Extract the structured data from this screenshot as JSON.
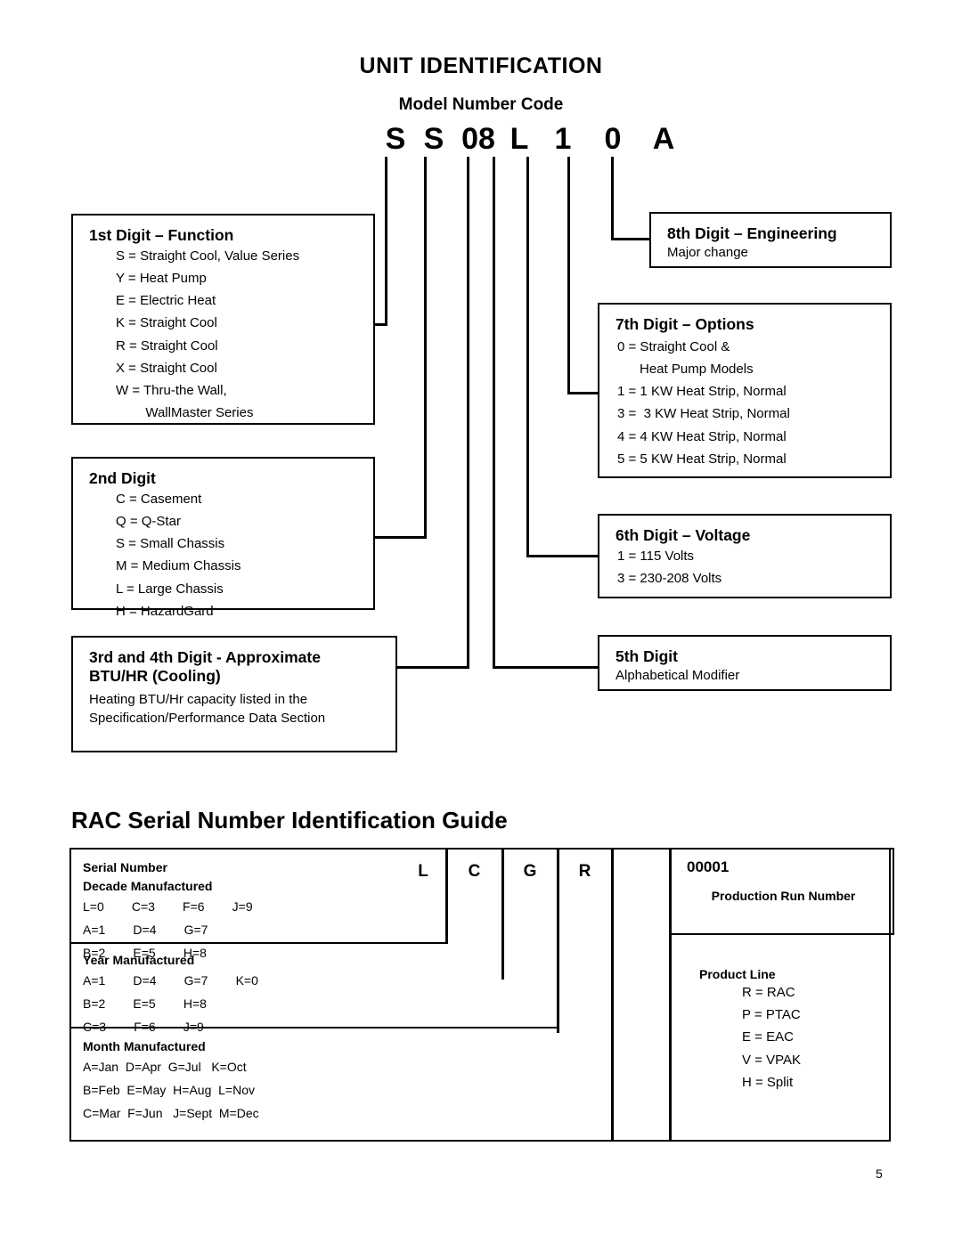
{
  "page": {
    "title": "UNIT IDENTIFICATION",
    "subtitle": "Model Number Code",
    "page_number": "5"
  },
  "model_code": {
    "digits": [
      "S",
      "S",
      "08",
      "L",
      "1",
      "0",
      "A"
    ]
  },
  "boxes": {
    "first_digit": {
      "heading": "1st Digit – Function",
      "items": [
        "S = Straight Cool, Value Series",
        "Y = Heat Pump",
        "E = Electric Heat",
        "K = Straight Cool",
        "R = Straight Cool",
        "X = Straight Cool",
        "W = Thru-the Wall,",
        "        WallMaster Series"
      ]
    },
    "second_digit": {
      "heading": "2nd Digit",
      "items": [
        "C = Casement",
        "Q = Q-Star",
        "S = Small Chassis",
        "M = Medium Chassis",
        "L = Large Chassis",
        "H = HazardGard"
      ]
    },
    "third_fourth_digit": {
      "heading": "3rd and 4th Digit - Approximate BTU/HR (Cooling)",
      "body_line1": "Heating BTU/Hr capacity listed in the",
      "body_line2": "Specification/Performance Data Section"
    },
    "fifth_digit": {
      "heading": "5th Digit",
      "body": "Alphabetical Modifier"
    },
    "sixth_digit": {
      "heading": "6th Digit – Voltage",
      "items": [
        "1 = 115 Volts",
        "3 = 230-208 Volts"
      ]
    },
    "seventh_digit": {
      "heading": "7th Digit – Options",
      "items": [
        "0 = Straight Cool &",
        "      Heat Pump Models",
        "1 = 1 KW Heat Strip, Normal",
        "3 =  3 KW Heat Strip, Normal",
        "4 = 4 KW Heat Strip, Normal",
        "5 = 5 KW Heat Strip, Normal"
      ]
    },
    "eighth_digit": {
      "heading": "8th Digit – Engineering",
      "body": "Major change"
    }
  },
  "serial_guide": {
    "heading": "RAC Serial Number Identification Guide",
    "code_cells": [
      "L",
      "C",
      "G",
      "R"
    ],
    "production_run": {
      "value": "00001",
      "label": "Production Run Number"
    },
    "decade": {
      "title_line1": "Serial Number",
      "title_line2": "Decade Manufactured",
      "rows": [
        "L=0        C=3        F=6        J=9",
        "A=1        D=4        G=7",
        "B=2        E=5        H=8"
      ]
    },
    "year": {
      "title": "Year Manufactured",
      "rows": [
        "A=1        D=4        G=7        K=0",
        "B=2        E=5        H=8",
        "C=3        F=6        J=9"
      ]
    },
    "month": {
      "title": "Month Manufactured",
      "rows": [
        "A=Jan  D=Apr  G=Jul   K=Oct",
        "B=Feb  E=May  H=Aug  L=Nov",
        "C=Mar  F=Jun   J=Sept  M=Dec"
      ]
    },
    "product_line": {
      "title": "Product Line",
      "items": [
        "R = RAC",
        "P = PTAC",
        "E = EAC",
        "V = VPAK",
        "H = Split"
      ]
    }
  }
}
